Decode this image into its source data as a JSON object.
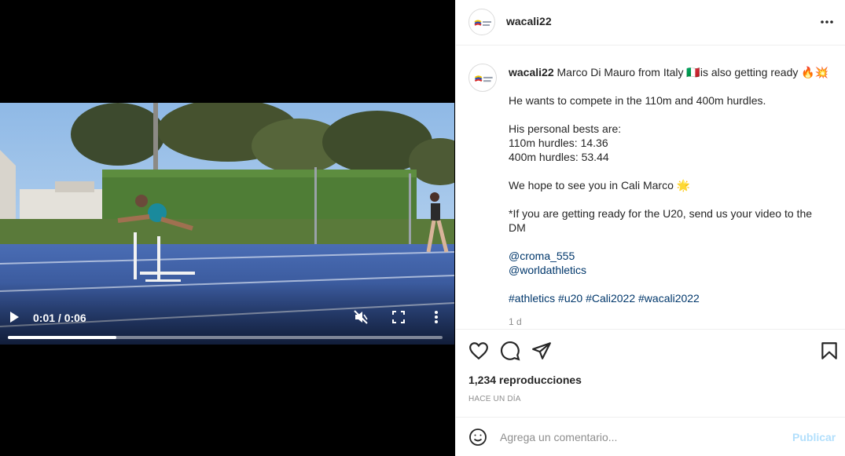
{
  "video": {
    "time_display": "0:01 / 0:06",
    "progress": 0.25,
    "muted": true,
    "icons": [
      "play-icon",
      "muted-speaker-icon",
      "fullscreen-icon",
      "vertical-dots-icon"
    ]
  },
  "header": {
    "username": "wacali22",
    "more_icon": "horizontal-dots-icon"
  },
  "caption": {
    "username": "wacali22",
    "line1": "Marco Di Mauro from Italy 🇮🇹is also getting ready 🔥💥",
    "line2": "He wants to compete in the 110m and 400m hurdles.",
    "bests_title": "His personal bests are:",
    "best_110": "110m hurdles: 14.36",
    "best_400": "400m hurdles: 53.44",
    "hope": "We hope to see you in Cali Marco 🌟",
    "u20_note": "*If you are getting ready for the U20, send us your video to the DM",
    "mention1": "@croma_555",
    "mention2": "@worldathletics",
    "hashtags": "#athletics #u20 #Cali2022 #wacali2022",
    "time_ago": "1 d"
  },
  "actions": {
    "icons": [
      "heart-icon",
      "comment-bubble-icon",
      "paper-plane-icon",
      "bookmark-icon"
    ],
    "views": "1,234 reproducciones",
    "posted_ago": "HACE UN DÍA"
  },
  "comment_box": {
    "placeholder": "Agrega un comentario...",
    "publish_label": "Publicar",
    "emoji_icon": "smiley-icon"
  },
  "colors": {
    "link": "#00376b",
    "publish_disabled": "#b2dffc",
    "muted_text": "#8e8e8e",
    "track_blue": "#3e5fa8"
  }
}
